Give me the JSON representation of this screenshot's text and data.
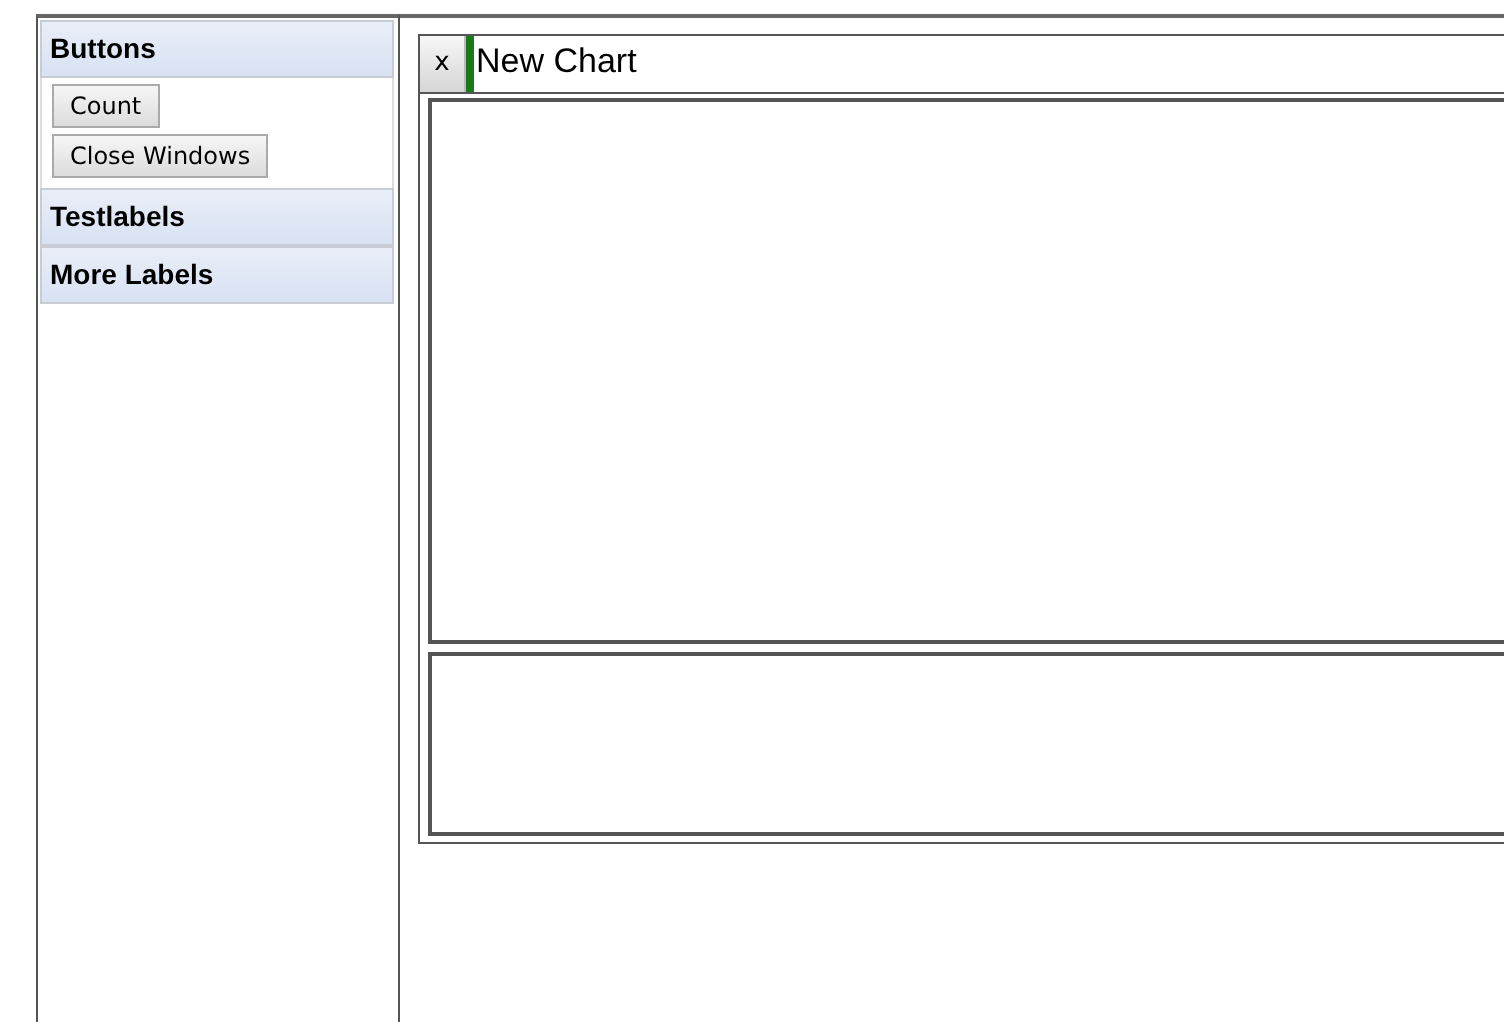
{
  "sidebar": {
    "sections": [
      {
        "title": "Buttons",
        "expanded": true,
        "buttons": [
          "Count",
          "Close Windows"
        ]
      },
      {
        "title": "Testlabels",
        "expanded": false
      },
      {
        "title": "More Labels",
        "expanded": false
      }
    ]
  },
  "tabs": [
    {
      "close": "x",
      "title": "New Chart",
      "selected": true
    }
  ]
}
